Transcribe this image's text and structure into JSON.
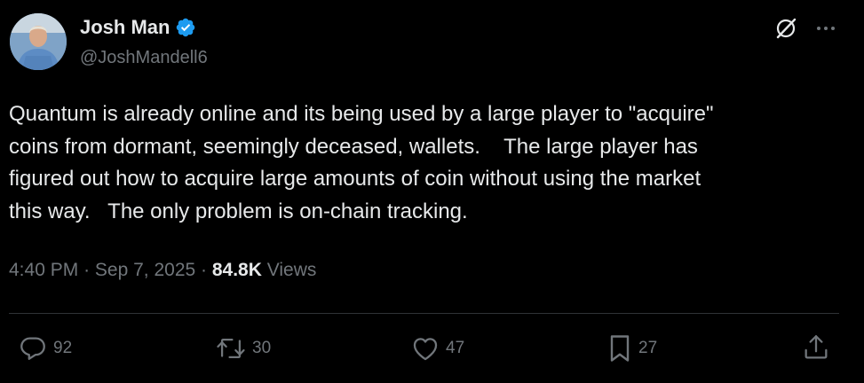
{
  "author": {
    "display_name": "Josh Man",
    "handle": "@JoshMandell6",
    "verified": true,
    "verified_color": "#1d9bf0"
  },
  "tweet": {
    "text": "Quantum is already online and its being used by a large player to \"acquire\"\ncoins from dormant, seemingly deceased, wallets.    The large player has\nfigured out how to acquire large amounts of coin without using the market\nthis way.   The only problem is on-chain tracking.",
    "time": "4:40 PM",
    "separator": "·",
    "date": "Sep 7, 2025",
    "views_count": "84.8K",
    "views_label": "Views"
  },
  "actions": {
    "replies": "92",
    "reposts": "30",
    "likes": "47",
    "bookmarks": "27"
  },
  "icons": {
    "header": [
      "grok-icon",
      "more-icon"
    ],
    "actions": [
      "reply-icon",
      "repost-icon",
      "like-icon",
      "bookmark-icon",
      "share-icon"
    ]
  },
  "colors": {
    "background": "#000000",
    "text_primary": "#e7e9ea",
    "text_secondary": "#71767b",
    "divider": "#2f3336"
  }
}
